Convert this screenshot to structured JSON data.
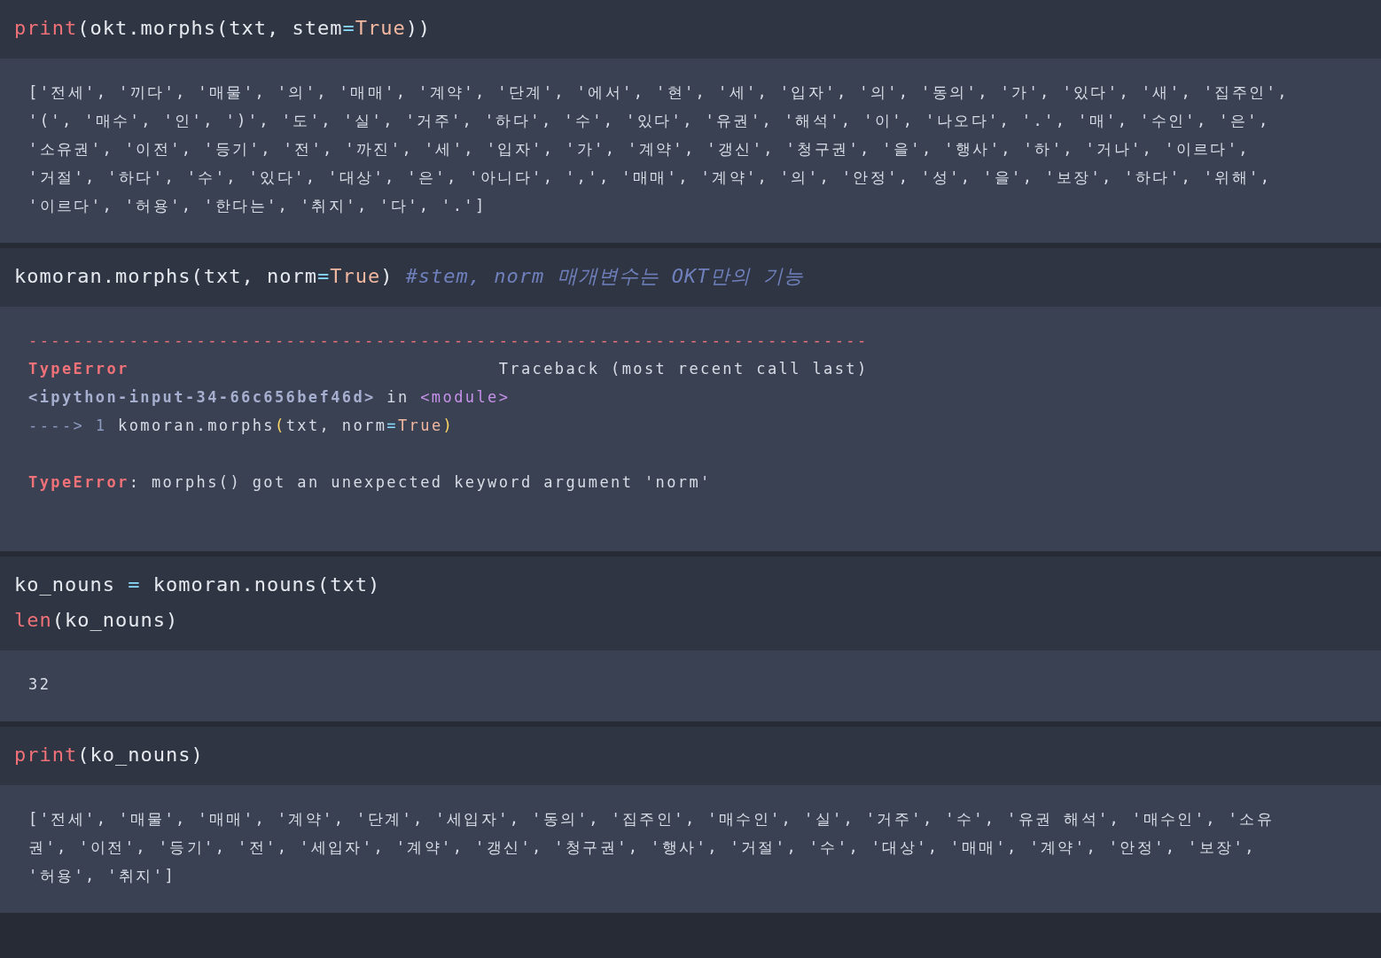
{
  "cells": [
    {
      "kind": "input",
      "blocks": [
        [
          [
            {
              "kind": "builtin",
              "text": "print"
            },
            {
              "kind": "plain",
              "text": "(okt.morphs(txt, stem"
            },
            {
              "kind": "op",
              "text": "="
            },
            {
              "kind": "const",
              "text": "True"
            },
            {
              "kind": "plain",
              "text": "))"
            }
          ]
        ]
      ]
    },
    {
      "kind": "output",
      "blocks": [
        [
          [
            {
              "kind": "plain",
              "text": "['전세', '끼다', '매물', '의', '매매', '계약', '단계', '에서', '현', '세', '입자', '의', '동의', '가', '있다', '새', '집주인',"
            }
          ],
          [
            {
              "kind": "plain",
              "text": "'(', '매수', '인', ')', '도', '실', '거주', '하다', '수', '있다', '유권', '해석', '이', '나오다', '.', '매', '수인', '은',"
            }
          ],
          [
            {
              "kind": "plain",
              "text": "'소유권', '이전', '등기', '전', '까진', '세', '입자', '가', '계약', '갱신', '청구권', '을', '행사', '하', '거나', '이르다',"
            }
          ],
          [
            {
              "kind": "plain",
              "text": "'거절', '하다', '수', '있다', '대상', '은', '아니다', ',', '매매', '계약', '의', '안정', '성', '을', '보장', '하다', '위해',"
            }
          ],
          [
            {
              "kind": "plain",
              "text": "'이르다', '허용', '한다는', '취지', '다', '.']"
            }
          ]
        ]
      ]
    },
    {
      "kind": "input",
      "blocks": [
        [
          [
            {
              "kind": "plain",
              "text": "komoran.morphs(txt, norm"
            },
            {
              "kind": "op",
              "text": "="
            },
            {
              "kind": "const",
              "text": "True"
            },
            {
              "kind": "plain",
              "text": ") "
            },
            {
              "kind": "comment",
              "text": "#stem, norm 매개변수는 OKT만의 기능"
            }
          ]
        ]
      ]
    },
    {
      "kind": "output",
      "blocks": [
        [
          [
            {
              "kind": "err",
              "text": "---------------------------------------------------------------------------"
            }
          ],
          [
            {
              "kind": "errname",
              "text": "TypeError"
            },
            {
              "kind": "plain",
              "text": "                                 Traceback (most recent call last)"
            }
          ],
          [
            {
              "kind": "loc",
              "text": "<ipython-input-34-66c656bef46d>"
            },
            {
              "kind": "plain",
              "text": " in "
            },
            {
              "kind": "module",
              "text": "<module>"
            }
          ],
          [
            {
              "kind": "arrow",
              "text": "----> 1 "
            },
            {
              "kind": "plain",
              "text": "komoran.morphs"
            },
            {
              "kind": "paren",
              "text": "("
            },
            {
              "kind": "plain",
              "text": "txt, norm"
            },
            {
              "kind": "op",
              "text": "="
            },
            {
              "kind": "const",
              "text": "True"
            },
            {
              "kind": "paren",
              "text": ")"
            }
          ]
        ],
        [
          [
            {
              "kind": "errname",
              "text": "TypeError"
            },
            {
              "kind": "plain",
              "text": ": morphs() got an unexpected keyword argument 'norm'"
            }
          ]
        ]
      ]
    },
    {
      "kind": "input",
      "blocks": [
        [
          [
            {
              "kind": "plain",
              "text": "ko_nouns "
            },
            {
              "kind": "op",
              "text": "="
            },
            {
              "kind": "plain",
              "text": " komoran.nouns(txt)"
            }
          ],
          [
            {
              "kind": "builtin",
              "text": "len"
            },
            {
              "kind": "plain",
              "text": "(ko_nouns)"
            }
          ]
        ]
      ]
    },
    {
      "kind": "output",
      "blocks": [
        [
          [
            {
              "kind": "plain",
              "text": "32"
            }
          ]
        ]
      ]
    },
    {
      "kind": "input",
      "blocks": [
        [
          [
            {
              "kind": "builtin",
              "text": "print"
            },
            {
              "kind": "plain",
              "text": "(ko_nouns)"
            }
          ]
        ]
      ]
    },
    {
      "kind": "output",
      "blocks": [
        [
          [
            {
              "kind": "plain",
              "text": "['전세', '매물', '매매', '계약', '단계', '세입자', '동의', '집주인', '매수인', '실', '거주', '수', '유권 해석', '매수인', '소유"
            }
          ],
          [
            {
              "kind": "plain",
              "text": "권', '이전', '등기', '전', '세입자', '계약', '갱신', '청구권', '행사', '거절', '수', '대상', '매매', '계약', '안정', '보장',"
            }
          ],
          [
            {
              "kind": "plain",
              "text": "'허용', '취지']"
            }
          ]
        ]
      ]
    }
  ]
}
